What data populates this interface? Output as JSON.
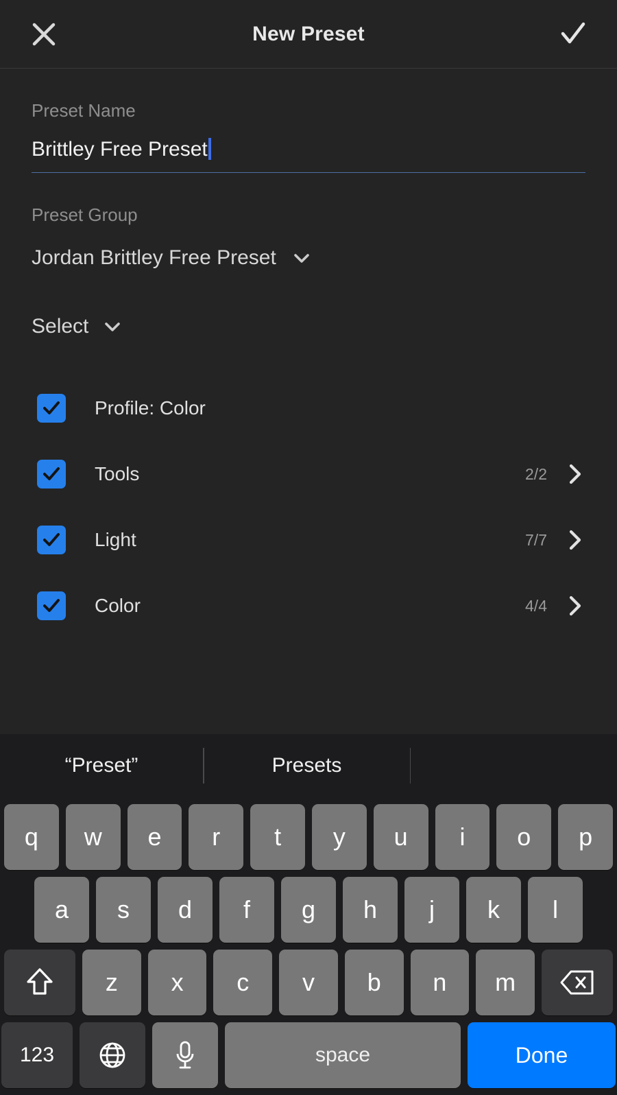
{
  "header": {
    "title": "New Preset",
    "close_icon": "close-x-icon",
    "confirm_icon": "checkmark-icon"
  },
  "form": {
    "name_label": "Preset Name",
    "name_value": "Brittley Free Preset",
    "group_label": "Preset Group",
    "group_value": "Jordan Brittley Free Preset",
    "select_label": "Select"
  },
  "checklist": [
    {
      "label": "Profile: Color",
      "count": "",
      "checked": true,
      "chevron": false
    },
    {
      "label": "Tools",
      "count": "2/2",
      "checked": true,
      "chevron": true
    },
    {
      "label": "Light",
      "count": "7/7",
      "checked": true,
      "chevron": true
    },
    {
      "label": "Color",
      "count": "4/4",
      "checked": true,
      "chevron": true
    }
  ],
  "keyboard": {
    "suggestions": [
      "“Preset”",
      "Presets",
      ""
    ],
    "row1": [
      "q",
      "w",
      "e",
      "r",
      "t",
      "y",
      "u",
      "i",
      "o",
      "p"
    ],
    "row2": [
      "a",
      "s",
      "d",
      "f",
      "g",
      "h",
      "j",
      "k",
      "l"
    ],
    "row3": [
      "z",
      "x",
      "c",
      "v",
      "b",
      "n",
      "m"
    ],
    "shift_icon": "shift-arrow-icon",
    "backspace_icon": "backspace-delete-icon",
    "numbers_key": "123",
    "globe_icon": "globe-language-icon",
    "mic_icon": "microphone-icon",
    "space_key": "space",
    "done_key": "Done"
  },
  "colors": {
    "accent_blue": "#2680EB",
    "done_blue": "#007AFF",
    "caret_blue": "#3d6de8",
    "underline_blue": "#4a6fa5",
    "background": "#242424",
    "keyboard_bg": "#1c1c1e",
    "key_gray": "#787878",
    "key_dark": "#3a3a3c"
  }
}
